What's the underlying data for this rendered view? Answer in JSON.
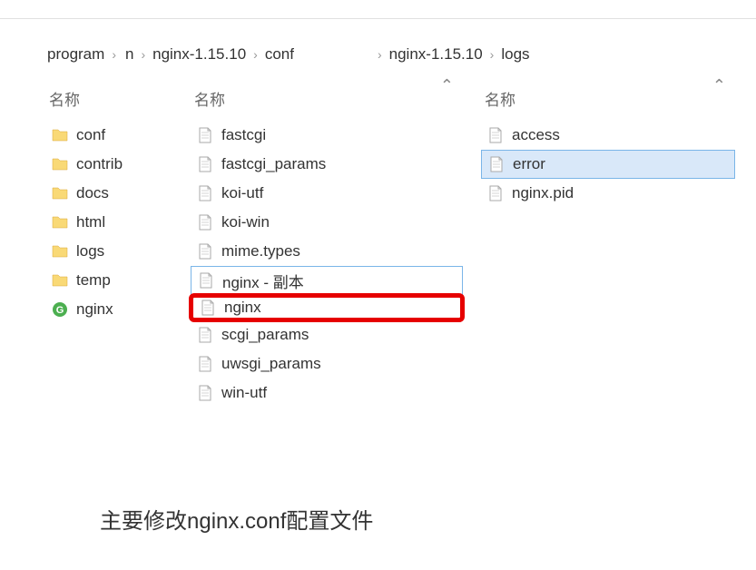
{
  "breadcrumbs": {
    "b1": "program",
    "b2": "n",
    "b3": "nginx-1.15.10",
    "b4": "conf",
    "b5": "nginx-1.15.10",
    "b6": "logs"
  },
  "columnHeader": "名称",
  "pane1": {
    "items": [
      {
        "name": "conf",
        "type": "folder"
      },
      {
        "name": "contrib",
        "type": "folder"
      },
      {
        "name": "docs",
        "type": "folder"
      },
      {
        "name": "html",
        "type": "folder"
      },
      {
        "name": "logs",
        "type": "folder"
      },
      {
        "name": "temp",
        "type": "folder"
      },
      {
        "name": "nginx",
        "type": "app"
      }
    ]
  },
  "pane2": {
    "items": [
      {
        "name": "fastcgi",
        "type": "file"
      },
      {
        "name": "fastcgi_params",
        "type": "file"
      },
      {
        "name": "koi-utf",
        "type": "file"
      },
      {
        "name": "koi-win",
        "type": "file"
      },
      {
        "name": "mime.types",
        "type": "file"
      },
      {
        "name": "nginx - 副本",
        "type": "file",
        "focused": true
      },
      {
        "name": "nginx",
        "type": "file",
        "highlighted": true
      },
      {
        "name": "scgi_params",
        "type": "file"
      },
      {
        "name": "uwsgi_params",
        "type": "file"
      },
      {
        "name": "win-utf",
        "type": "file"
      }
    ]
  },
  "pane3": {
    "items": [
      {
        "name": "access",
        "type": "file"
      },
      {
        "name": "error",
        "type": "file",
        "selected": true
      },
      {
        "name": "nginx.pid",
        "type": "file"
      }
    ]
  },
  "caption": "主要修改nginx.conf配置文件"
}
